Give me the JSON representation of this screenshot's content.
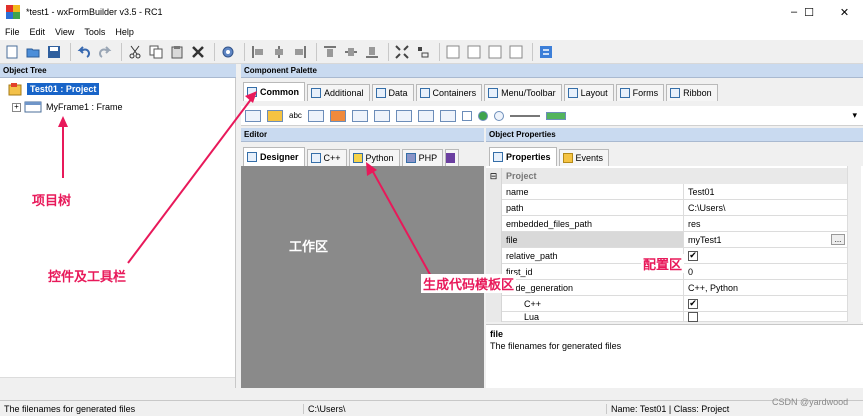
{
  "window": {
    "title": "*test1 - wxFormBuilder v3.5 - RC1",
    "controls": [
      "–",
      "☐",
      "✕"
    ]
  },
  "menu": [
    "File",
    "Edit",
    "View",
    "Tools",
    "Help"
  ],
  "object_tree": {
    "header": "Object Tree",
    "root": "Test01 : Project",
    "child": "MyFrame1 : Frame",
    "expander": "+"
  },
  "component_palette": {
    "header": "Component Palette",
    "tabs": [
      "Common",
      "Additional",
      "Data",
      "Containers",
      "Menu/Toolbar",
      "Layout",
      "Forms",
      "Ribbon"
    ],
    "text_item": "abc",
    "overflow_icon": "▾"
  },
  "editor": {
    "header": "Editor",
    "tabs": [
      "Designer",
      "C++",
      "Python",
      "PHP"
    ]
  },
  "object_properties": {
    "header": "Object Properties",
    "tabs": [
      "Properties",
      "Events"
    ],
    "section": "Project",
    "section_toggle": "⊟",
    "rows": [
      {
        "name": "name",
        "value": "Test01"
      },
      {
        "name": "path",
        "value": "C:\\Users\\"
      },
      {
        "name": "embedded_files_path",
        "value": "res"
      },
      {
        "name": "file",
        "value": "myTest1",
        "button": "..."
      },
      {
        "name": "relative_path",
        "value": "✔"
      },
      {
        "name": "first_id",
        "value": "0"
      },
      {
        "name": "code_generation",
        "value": "C++, Python"
      },
      {
        "name": "C++",
        "value": "✔"
      },
      {
        "name": "Lua",
        "value": ""
      }
    ],
    "description_title": "file",
    "description_text": "The filenames for generated files"
  },
  "status_bar": {
    "message": "The filenames for generated files",
    "path": "C:\\Users\\",
    "info": "Name: Test01 | Class: Project"
  },
  "annotations": {
    "project_tree": "项目树",
    "controls_toolbar": "控件及工具栏",
    "work_area": "工作区",
    "code_template_area": "生成代码模板区",
    "config_area": "配置区"
  },
  "watermark": "CSDN @yardwood",
  "colors": {
    "selection": "#1864c8",
    "panel_header": "#c9daf0",
    "annotation": "#e8195a",
    "editor_background": "#8a8a8a"
  }
}
